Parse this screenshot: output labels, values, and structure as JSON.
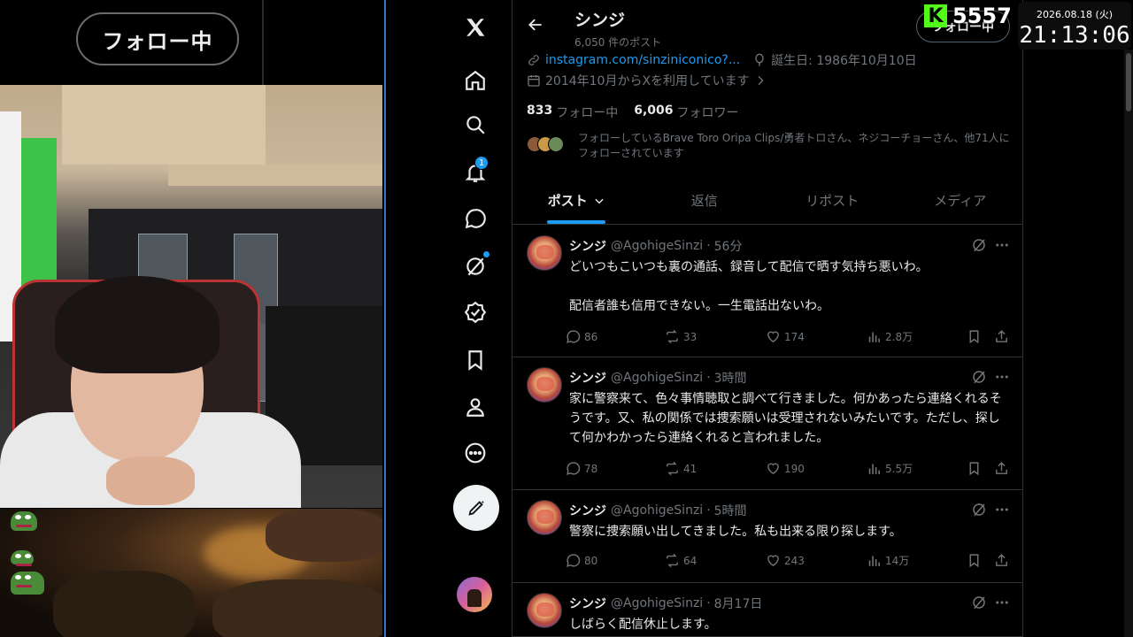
{
  "stream": {
    "follow_badge": "フォロー中",
    "viewer_count": "5557",
    "kick_logo": "K",
    "clock_date": "2026.08.18 (火)",
    "clock_time": "21:13:06"
  },
  "nav": {
    "notification_count": "1",
    "icons": [
      "x-logo-icon",
      "home-icon",
      "search-icon",
      "bell-icon",
      "messages-icon",
      "grok-icon",
      "verified-icon",
      "bookmark-icon",
      "profile-icon",
      "more-icon",
      "compose-icon"
    ]
  },
  "profile": {
    "name": "シンジ",
    "post_count": "6,050 件のポスト",
    "follow_button": "フォロー中",
    "link": "instagram.com/sinziniconico?...",
    "birthday": "誕生日: 1986年10月10日",
    "joined": "2014年10月からXを利用しています",
    "following_count": "833",
    "following_label": "フォロー中",
    "followers_count": "6,006",
    "followers_label": "フォロワー",
    "followers_you_know": "フォローしているBrave Toro Oripa Clips/勇者トロさん、ネジコーチョーさん、他71人にフォローされています"
  },
  "tabs": [
    {
      "label": "ポスト",
      "active": true
    },
    {
      "label": "返信",
      "active": false
    },
    {
      "label": "リポスト",
      "active": false
    },
    {
      "label": "メディア",
      "active": false
    }
  ],
  "posts": [
    {
      "name": "シンジ",
      "handle": "@AgohigeSinzi",
      "time": "56分",
      "body": "どいつもこいつも裏の通話、録音して配信で晒す気持ち悪いわ。\n\n配信者誰も信用できない。一生電話出ないわ。",
      "replies": "86",
      "reposts": "33",
      "likes": "174",
      "views": "2.8万"
    },
    {
      "name": "シンジ",
      "handle": "@AgohigeSinzi",
      "time": "3時間",
      "body": "家に警察来て、色々事情聴取と調べて行きました。何かあったら連絡くれるそうです。又、私の関係では捜索願いは受理されないみたいです。ただし、探して何かわかったら連絡くれると言われました。",
      "replies": "78",
      "reposts": "41",
      "likes": "190",
      "views": "5.5万"
    },
    {
      "name": "シンジ",
      "handle": "@AgohigeSinzi",
      "time": "5時間",
      "body": "警察に捜索願い出してきました。私も出来る限り探します。",
      "replies": "80",
      "reposts": "64",
      "likes": "243",
      "views": "14万"
    },
    {
      "name": "シンジ",
      "handle": "@AgohigeSinzi",
      "time": "8月17日",
      "body": "しばらく配信休止します。"
    }
  ],
  "colors": {
    "accent": "#1d9bf0",
    "kick_green": "#53fc18",
    "muted_text": "#71767b",
    "divider": "#2f3336"
  }
}
